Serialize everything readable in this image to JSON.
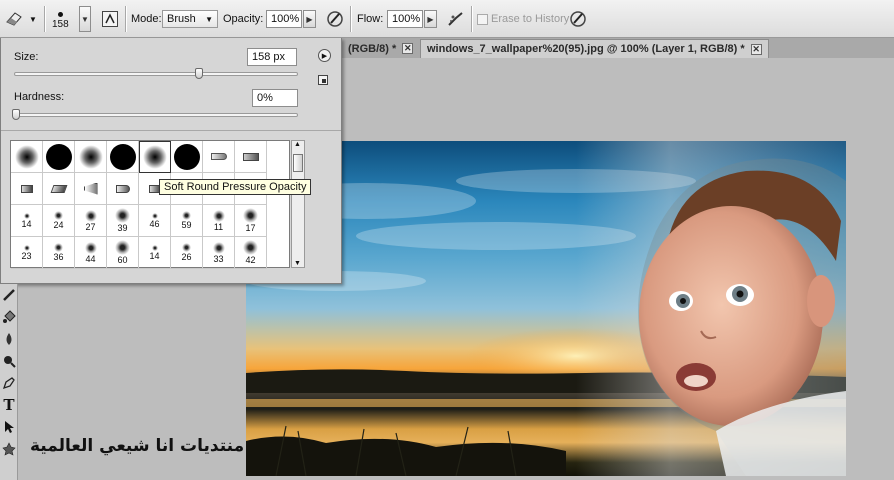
{
  "options_bar": {
    "brush_size_value": "158",
    "mode_label": "Mode:",
    "mode_value": "Brush",
    "opacity_label": "Opacity:",
    "opacity_value": "100%",
    "flow_label": "Flow:",
    "flow_value": "100%",
    "erase_to_history_label": "Erase to History"
  },
  "tabs": [
    {
      "label": "(RGB/8) *"
    },
    {
      "label": "windows_7_wallpaper%20(95).jpg @ 100% (Layer 1, RGB/8) *"
    }
  ],
  "brush_panel": {
    "size_label": "Size:",
    "size_value": "158 px",
    "size_fraction": 0.65,
    "hardness_label": "Hardness:",
    "hardness_value": "0%",
    "hardness_fraction": 0.0,
    "tooltip": "Soft Round Pressure Opacity",
    "presets_row3": [
      "14",
      "24",
      "27",
      "39",
      "46",
      "59",
      "11",
      "17"
    ],
    "presets_row4": [
      "23",
      "36",
      "44",
      "60",
      "14",
      "26",
      "33",
      "42"
    ]
  },
  "tool_icons": [
    "brush-tool-icon",
    "paint-bucket-icon",
    "blur-icon",
    "dodge-icon",
    "pen-tool-icon",
    "type-tool-icon",
    "path-selection-icon",
    "shape-tool-icon"
  ],
  "watermark_text": "منتديات انا شيعي العالمية",
  "colors": {
    "panel": "#d6d6d6",
    "workspace": "#bdbdbd",
    "tooltip_bg": "#ffffe1"
  }
}
